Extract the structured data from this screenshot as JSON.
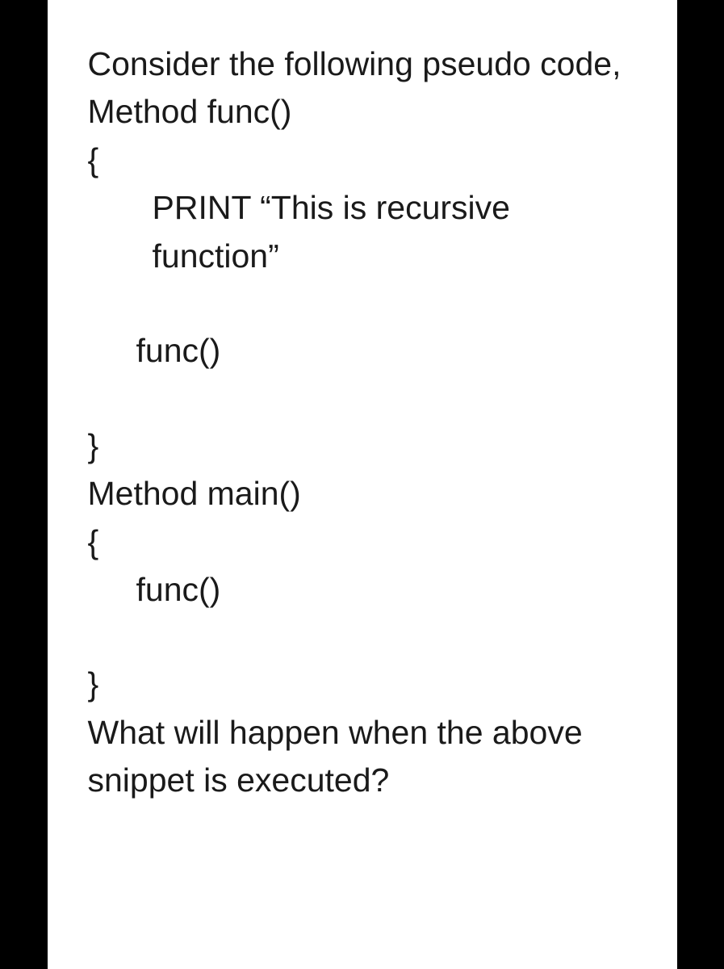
{
  "lines": {
    "l0": "Consider the following pseudo code,",
    "l1": "Method func()",
    "l2": "{",
    "l3": "PRINT “This is recursive function”",
    "l4": "func()",
    "l5": "}",
    "l6": "Method main()",
    "l7": "{",
    "l8": "func()",
    "l9": "}",
    "l10": "What will happen when the above snippet is executed?"
  }
}
